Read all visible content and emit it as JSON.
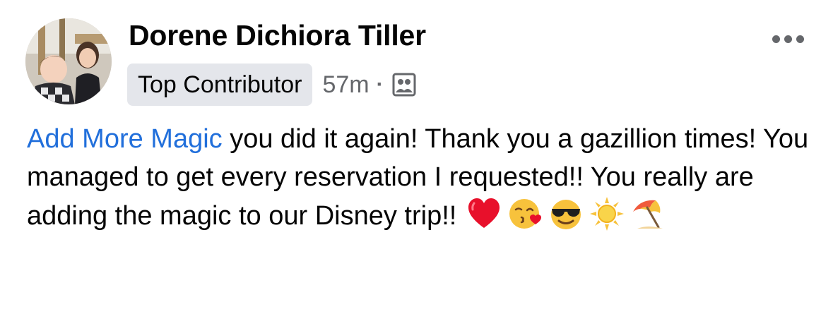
{
  "post": {
    "author_name": "Dorene Dichiora Tiller",
    "badge": "Top Contributor",
    "timestamp": "57m",
    "separator": "·",
    "audience_icon": "group-members-icon",
    "mention": "Add More Magic",
    "body_text": " you did it again! Thank you a gazillion times! You managed to get every reservation I requested!! You really are adding the magic to our Disney trip!!",
    "emojis": [
      "red-heart-icon",
      "face-blowing-kiss-icon",
      "smiling-face-sunglasses-icon",
      "sun-icon",
      "beach-umbrella-icon"
    ]
  },
  "colors": {
    "mention": "#216fdb",
    "secondary_text": "#65676b",
    "badge_bg": "#e4e6eb"
  }
}
